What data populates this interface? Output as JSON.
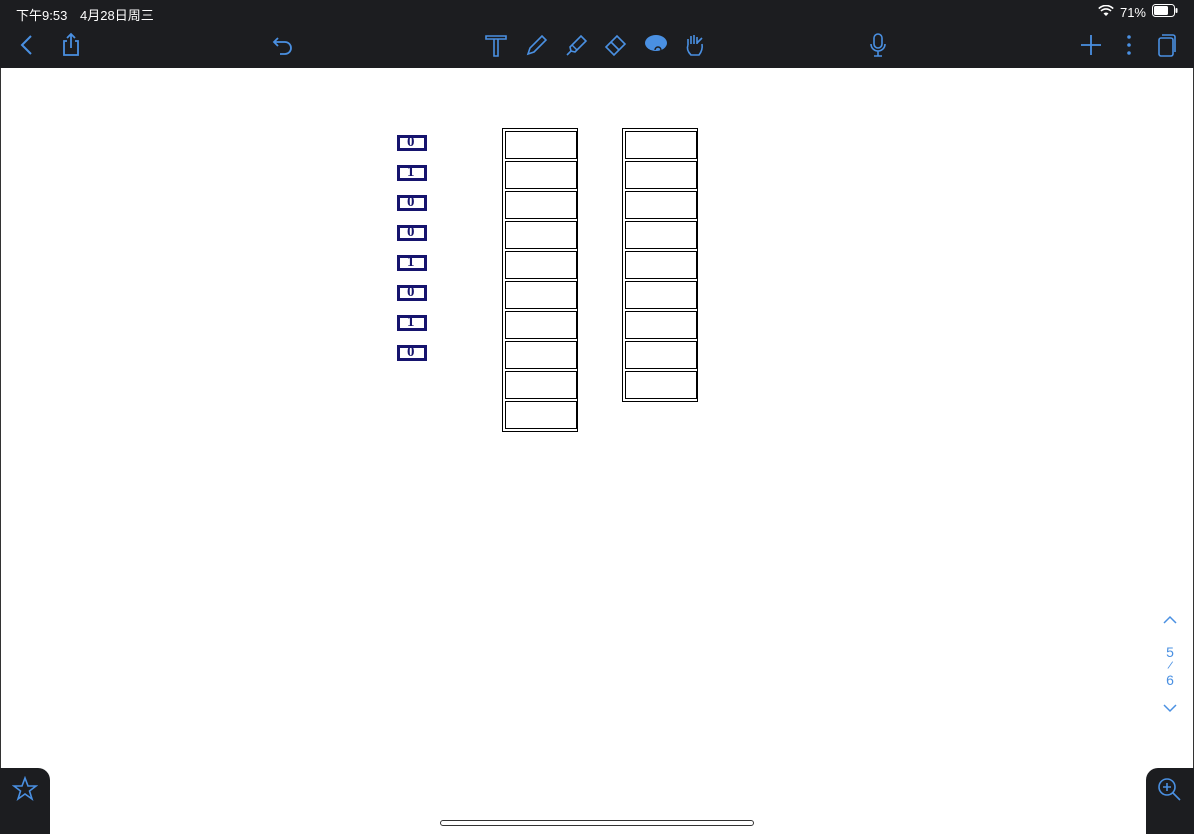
{
  "status_bar": {
    "time": "下午9:53",
    "date": "4月28日周三",
    "battery": "71%"
  },
  "toolbar": {
    "left_icons": [
      "back-icon",
      "share-icon",
      "undo-icon"
    ],
    "center_icons": [
      "text-tool-icon",
      "pen-icon",
      "highlighter-icon",
      "eraser-icon",
      "lasso-icon",
      "hand-icon"
    ],
    "right_icons": [
      "microphone-icon",
      "add-icon",
      "more-icon",
      "pages-icon"
    ]
  },
  "colors": {
    "toolbar_bg": "#1c1d20",
    "accent": "#4a90e2",
    "binary_ink": "#16146e"
  },
  "binary_digits": [
    "0",
    "1",
    "0",
    "0",
    "1",
    "0",
    "1",
    "0"
  ],
  "columns": [
    {
      "cells": 10
    },
    {
      "cells": 9
    }
  ],
  "page_nav": {
    "current": "5",
    "separator": "/",
    "total": "6"
  }
}
